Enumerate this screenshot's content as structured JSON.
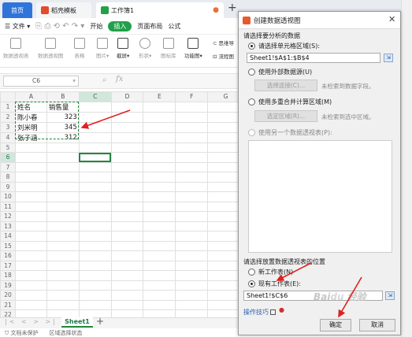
{
  "tabs": {
    "home": "首页",
    "template": "稻壳模板",
    "workbook": "工作簿1",
    "add": "+"
  },
  "menu": {
    "file": "文件",
    "start": "开始",
    "insert": "插入",
    "page_layout": "页面布局",
    "formula": "公式"
  },
  "ribbon": {
    "pivot_table": "数据透视表",
    "pivot_chart": "数据透视图",
    "table": "表格",
    "picture": "图片",
    "screenshot": "截屏",
    "shapes": "形状",
    "icon_lib": "图标库",
    "func_chart": "功能图",
    "mind_map": "思维导",
    "flowchart": "流程图"
  },
  "formula_bar": {
    "cell_ref": "C6",
    "fx": "fx"
  },
  "grid": {
    "columns": [
      "A",
      "B",
      "C",
      "D",
      "E",
      "F",
      "G"
    ],
    "rows": [
      [
        "姓名",
        "销售量",
        ""
      ],
      [
        "陈小春",
        "323",
        ""
      ],
      [
        "刘米明",
        "345",
        ""
      ],
      [
        "张子涵",
        "312",
        ""
      ]
    ],
    "row_count": 23
  },
  "sheet_bar": {
    "sheet_tab": "Sheet1",
    "add": "+",
    "status_left": "文档未保护",
    "status_right": "区域选择状态"
  },
  "dialog": {
    "title": "创建数据透视图",
    "section_source": "请选择要分析的数据",
    "opt_select_range": "请选择单元格区域(S):",
    "range_value": "Sheet1!$A$1:$B$4",
    "opt_external": "使用外部数据源(U)",
    "btn_choose_conn": "选择连接(C)...",
    "hint_no_fields": "未检索到数据字段。",
    "opt_multi": "使用多重合并计算区域(M)",
    "btn_choose_region": "选定区域(R)...",
    "hint_no_region": "未检索到选中区域。",
    "opt_other_pivot": "使用另一个数据透视表(P):",
    "section_place": "请选择放置数据透视表的位置",
    "opt_new_sheet": "新工作表(N)",
    "opt_existing": "现有工作表(E):",
    "place_value": "Sheet1!$C$6",
    "tips": "操作技巧",
    "ok": "确定",
    "cancel": "取消"
  },
  "watermark": "Baidu经验",
  "colors": {
    "accent_green": "#22883e",
    "home_tab": "#2f74d9",
    "annotation_red": "#e02020"
  }
}
